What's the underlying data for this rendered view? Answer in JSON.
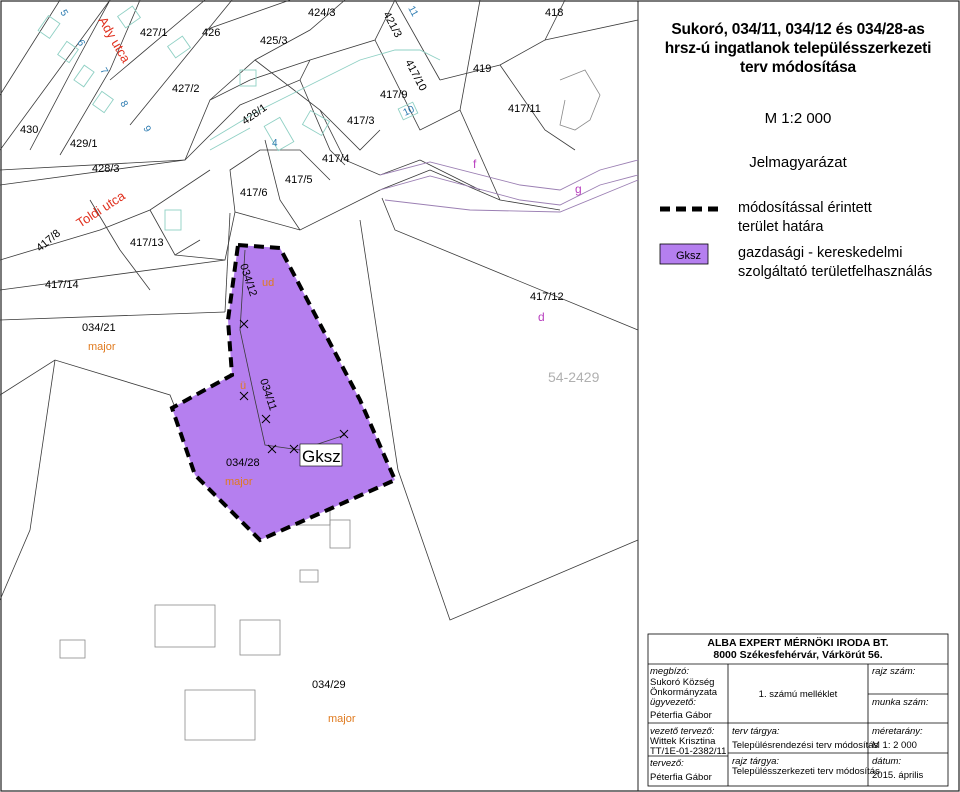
{
  "colors": {
    "cadastre_line": "#3a3a3a",
    "road_line": "#9b7fb3",
    "building_line": "#8fd0c4",
    "gksz_fill": "#b57fef",
    "boundary": "#000000",
    "street_text": "#e0301e",
    "parcel_number_text": "#2a7ab0",
    "letter_text": "#b83fbf",
    "major_text": "#e07a1e",
    "ghost_text": "#b0b0b0"
  },
  "map": {
    "parcel_labels": [
      "5",
      "6",
      "7",
      "8",
      "9",
      "427/1",
      "426",
      "425/3",
      "424/3",
      "421/3",
      "11",
      "418",
      "427/2",
      "417/10",
      "417/9",
      "419",
      "430",
      "429/1",
      "428/1",
      "4",
      "417/3",
      "10",
      "417/11",
      "428/3",
      "417/4",
      "417/5",
      "417/6",
      "417/8",
      "417/13",
      "417/14",
      "034/12",
      "417/12",
      "034/21",
      "034/11",
      "034/28",
      "034/29"
    ],
    "streets": [
      "Ady utca",
      "Toldi utca"
    ],
    "letters": [
      "f",
      "g",
      "ud",
      "d",
      "ü"
    ],
    "major_labels": [
      "major",
      "major",
      "major"
    ],
    "ghost_number": "54-2429",
    "gksz_label": "Gksz"
  },
  "title": {
    "line1": "Sukoró, 034/11, 034/12 és 034/28-as",
    "line2": "hrsz-ú ingatlanok településszerkezeti",
    "line3": "terv módosítása"
  },
  "scale": "M 1:2 000",
  "legend": {
    "heading": "Jelmagyarázat",
    "items": [
      {
        "symbol": "dashed-line",
        "text_line1": "módosítással érintett",
        "text_line2": "terület határa"
      },
      {
        "symbol": "Gksz",
        "text_line1": "gazdasági - kereskedelmi",
        "text_line2": "szolgáltató területfelhasználás"
      }
    ]
  },
  "title_block": {
    "firm": "ALBA EXPERT MÉRNÖKI IRODA BT.",
    "address": "8000   Székesfehérvár, Várkörút 56.",
    "client_label": "megbízó:",
    "client_line1": "Sukoró Község",
    "client_line2": "Önkormányzata",
    "manager_label": "ügyvezető:",
    "manager": "Péterfia Gábor",
    "attachment": "1. számú melléklet",
    "drawing_no_label": "rajz szám:",
    "work_no_label": "munka szám:",
    "lead_label": "vezető tervező:",
    "lead_name": "Wittek Krisztina",
    "lead_id": "TT/1E-01-2382/11",
    "designer_label": "tervező:",
    "designer": "Péterfia Gábor",
    "plan_subject_label": "terv tárgya:",
    "plan_subject": "Településrendezési terv módosítás",
    "drawing_subject_label": "rajz tárgya:",
    "drawing_subject": "Településszerkezeti terv módosítás",
    "scale_label": "méretarány:",
    "scale_value": "M 1: 2 000",
    "date_label": "dátum:",
    "date_value": "2015. április"
  }
}
